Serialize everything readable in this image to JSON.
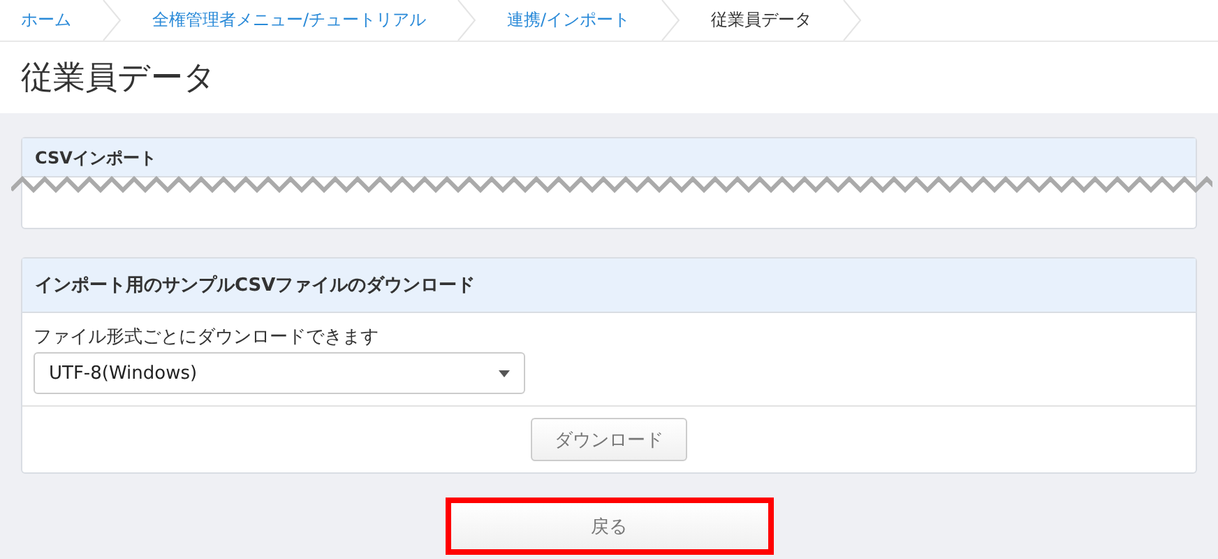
{
  "breadcrumb": [
    {
      "label": "ホーム",
      "current": false
    },
    {
      "label": "全権管理者メニュー/チュートリアル",
      "current": false
    },
    {
      "label": "連携/インポート",
      "current": false
    },
    {
      "label": "従業員データ",
      "current": true
    }
  ],
  "page_title": "従業員データ",
  "csv_import_card": {
    "title": "CSVインポート",
    "torn": true
  },
  "sample_card": {
    "title": "インポート用のサンプルCSVファイルのダウンロード",
    "label": "ファイル形式ごとにダウンロードできます",
    "select_value": "UTF-8(Windows)",
    "button": "ダウンロード"
  },
  "back_button": {
    "label": "戻る",
    "highlighted": true
  }
}
